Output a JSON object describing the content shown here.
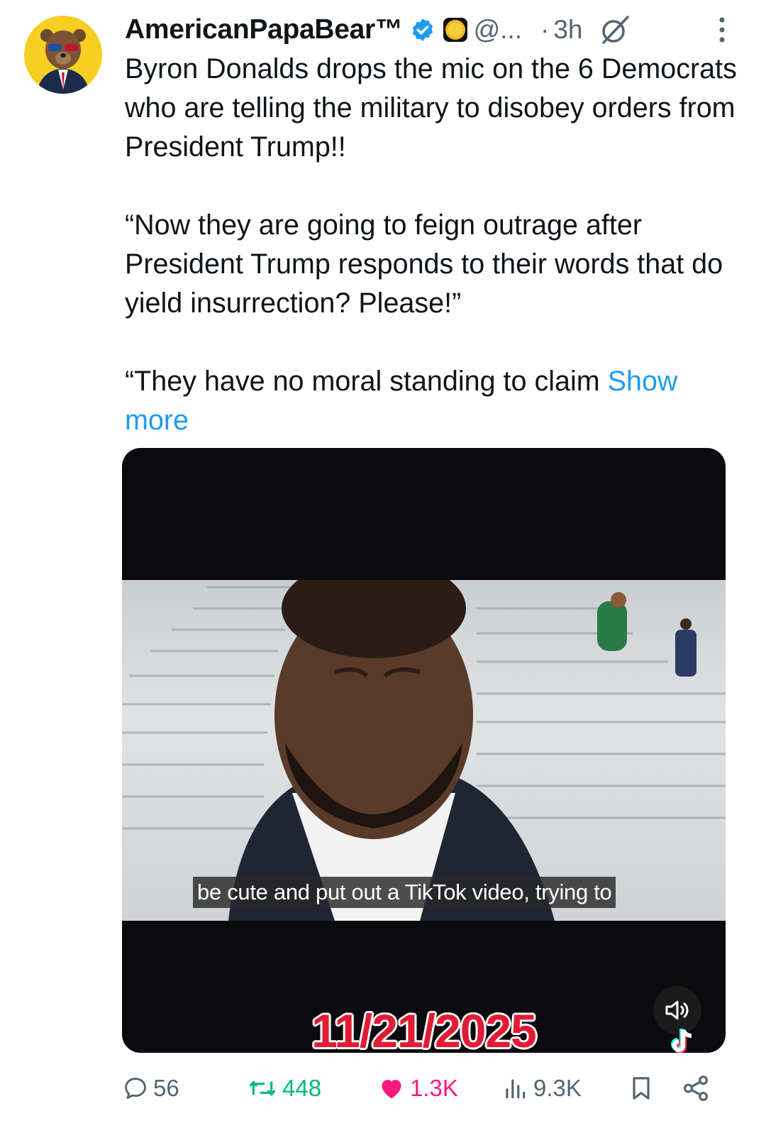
{
  "post": {
    "author_name": "AmericanPapaBear™",
    "handle": "@...",
    "separator": "·",
    "time": "3h",
    "body_paragraph_1": "Byron Donalds drops the mic on the 6 Democrats who are telling the military to disobey orders from President Trump!!",
    "body_paragraph_2": "“Now they are going to feign outrage after President Trump responds to their words that do yield insurrection? Please!”",
    "body_paragraph_3": "“They have no moral standing to claim",
    "show_more": "Show more"
  },
  "media": {
    "subtitle": "be cute and put out a TikTok video, trying to",
    "date_overlay": "11/21/2025"
  },
  "actions": {
    "replies": "56",
    "reposts": "448",
    "likes": "1.3K",
    "views": "9.3K"
  },
  "colors": {
    "link": "#1d9bf0",
    "repost": "#00ba7c",
    "like": "#f91880",
    "verified": "#1d9bf0",
    "secondary_text": "#536471"
  },
  "icons": [
    "verified-badge-icon",
    "gold-coin-icon",
    "grok-icon",
    "more-vertical-icon",
    "volume-icon",
    "tiktok-logo-icon",
    "reply-icon",
    "repost-icon",
    "like-heart-icon",
    "views-chart-icon",
    "bookmark-icon",
    "share-icon"
  ]
}
